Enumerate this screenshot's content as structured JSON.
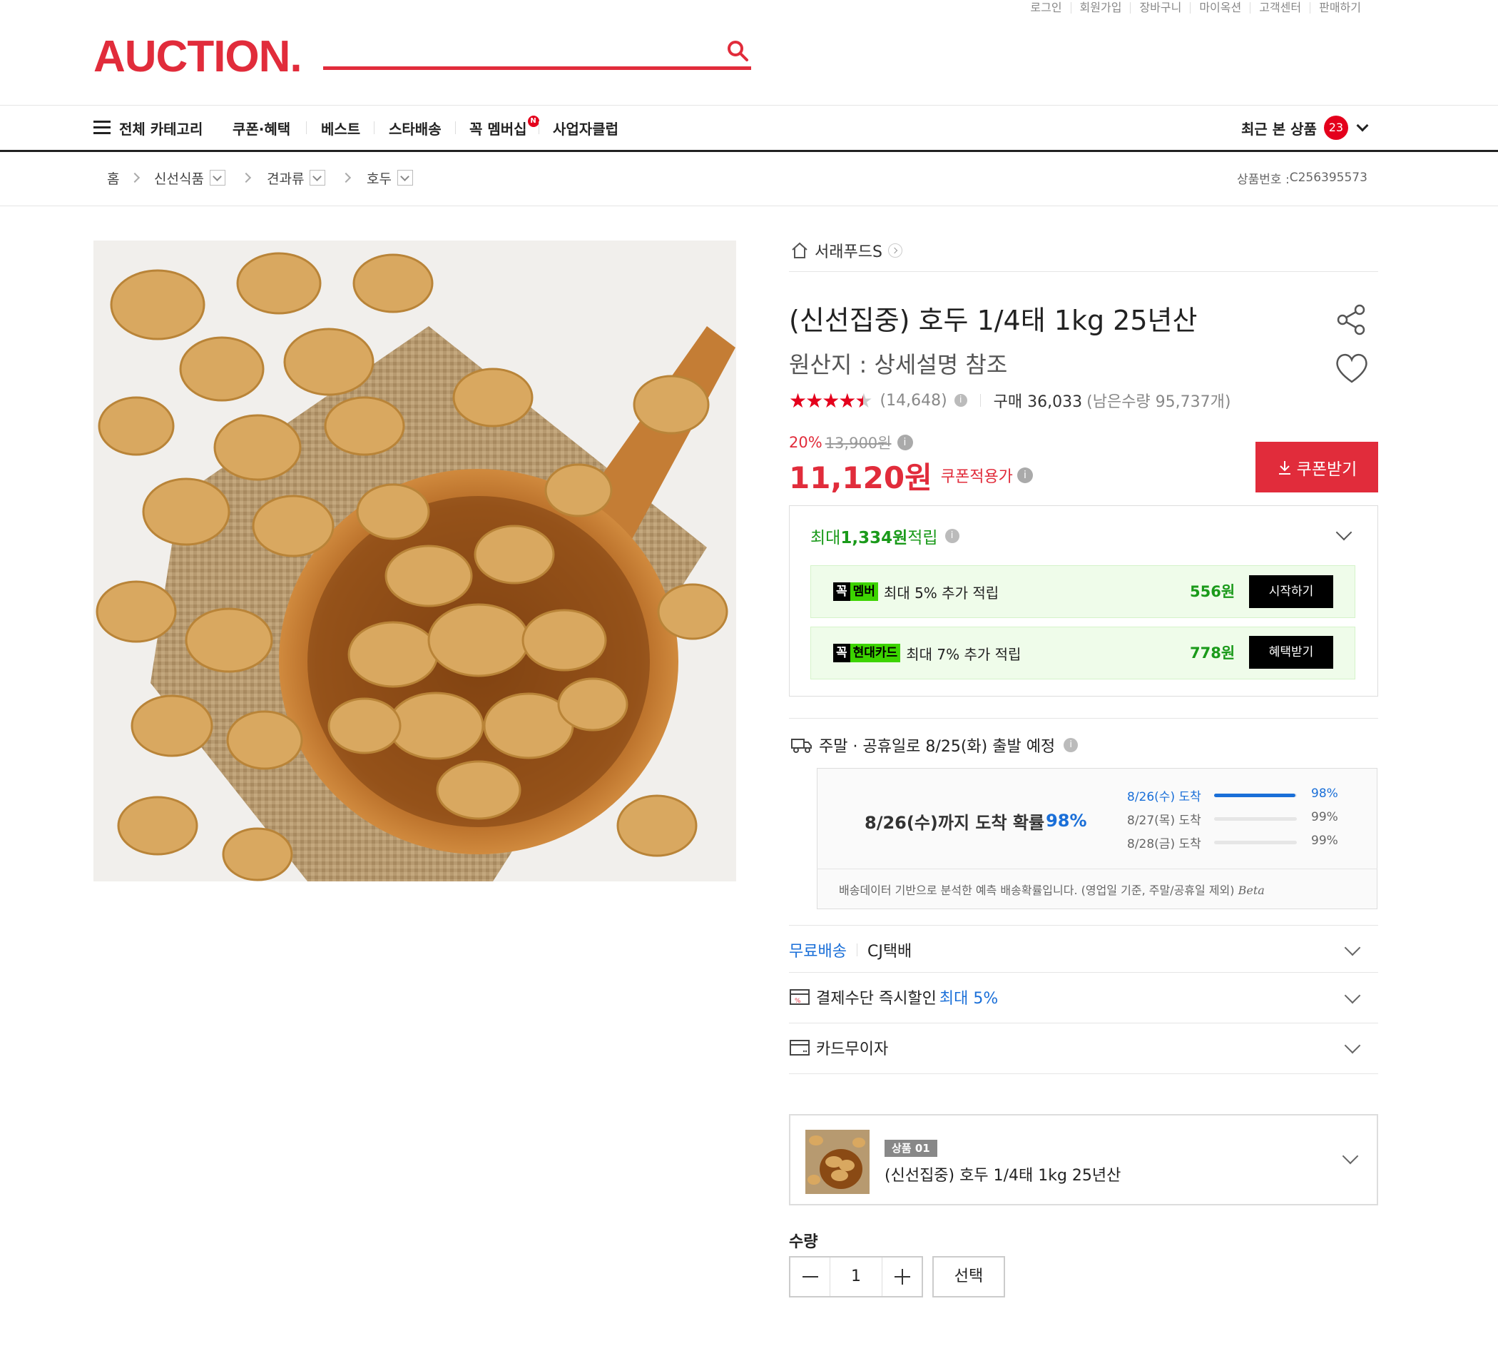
{
  "header": {
    "util_links": [
      "로그인",
      "회원가입",
      "장바구니",
      "마이옥션",
      "고객센터",
      "판매하기"
    ],
    "logo": "AUCTION.",
    "search_placeholder": ""
  },
  "gnb": {
    "all_categories": "전체 카테고리",
    "items": [
      "쿠폰·혜택",
      "베스트",
      "스타배송",
      "꼭 멤버십",
      "사업자클럽"
    ],
    "membership_badge": "N",
    "recent_label": "최근 본 상품",
    "recent_count": "23"
  },
  "breadcrumb": {
    "home": "홈",
    "levels": [
      "신선식품",
      "견과류",
      "호두"
    ],
    "product_no_label": "상품번호 : ",
    "product_no": "C256395573"
  },
  "product": {
    "seller": "서래푸드S",
    "title": "(신선집중) 호두 1/4태 1kg 25년산",
    "subtitle": "원산지 : 상세설명 참조",
    "rating": 4.5,
    "review_count": "(14,648)",
    "purchase_label": "구매 36,033",
    "stock_label": "(남은수량 95,737개)",
    "discount_rate": "20%",
    "original_price": "13,900원",
    "price": "11,120원",
    "price_note": "쿠폰적용가",
    "coupon_button": "쿠폰받기"
  },
  "points": {
    "summary_prefix": "최대 ",
    "summary_amount": "1,334원",
    "summary_suffix": " 적립",
    "rows": [
      {
        "tag_a": "꼭",
        "tag_b": "멤버",
        "text": "최대 5% 추가 적립",
        "amount": "556원",
        "button": "시작하기"
      },
      {
        "tag_a": "꼭",
        "tag_b": "현대카드",
        "text": "최대 7% 추가 적립",
        "amount": "778원",
        "button": "혜택받기"
      }
    ]
  },
  "delivery": {
    "ship_text": "주말 · 공휴일로 8/25(화) 출발 예정",
    "prob_text": "8/26(수)까지 도착 확률 ",
    "prob_value": "98%",
    "rows": [
      {
        "label": "8/26(수) 도착",
        "pct": "98%",
        "fill": 0.98
      },
      {
        "label": "8/27(목) 도착",
        "pct": "99%",
        "fill": 0.0
      },
      {
        "label": "8/28(금) 도착",
        "pct": "99%",
        "fill": 0.0
      }
    ],
    "note": "배송데이터 기반으로 분석한 예측 배송확률입니다. (영업일 기준, 주말/공휴일 제외)",
    "beta": "Beta"
  },
  "options": {
    "free_ship": "무료배송",
    "courier": "CJ택배",
    "pay_discount": "결제수단 즉시할인 ",
    "pay_discount_highlight": "최대 5%",
    "installment": "카드무이자"
  },
  "selection": {
    "tag": "상품 01",
    "name": "(신선집중) 호두 1/4태 1kg 25년산",
    "qty_label": "수량",
    "qty_value": "1",
    "select_button": "선택"
  },
  "colors": {
    "brand": "#e12c3b",
    "green": "#1a9a1a",
    "blue": "#1a6fd8"
  }
}
